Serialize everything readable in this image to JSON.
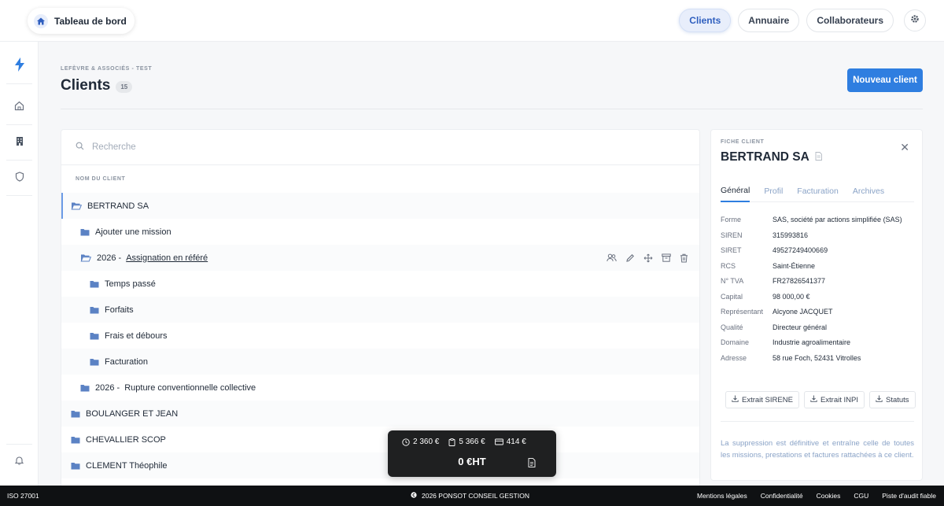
{
  "topbar": {
    "home_label": "Tableau de bord",
    "nav": [
      "Clients",
      "Annuaire",
      "Collaborateurs"
    ],
    "active_nav": "Clients"
  },
  "rail": {
    "icons": [
      "bolt-icon",
      "home-icon",
      "building-icon",
      "shield-icon",
      "bell-icon"
    ]
  },
  "header": {
    "org": "LEFÈVRE & ASSOCIÉS - TEST",
    "title": "Clients",
    "count": "15",
    "new_client": "Nouveau client"
  },
  "search": {
    "placeholder": "Recherche"
  },
  "tree": {
    "column_header": "NOM DU CLIENT",
    "rows": [
      {
        "label": "BERTRAND SA",
        "level": 0,
        "open": true,
        "selected": true
      },
      {
        "label": "Ajouter une mission",
        "level": 1,
        "open": false
      },
      {
        "year": "2026 -",
        "label": "Assignation en référé",
        "level": 1,
        "open": true,
        "has_actions": true
      },
      {
        "label": "Temps passé",
        "level": 2,
        "open": false
      },
      {
        "label": "Forfaits",
        "level": 2,
        "open": false
      },
      {
        "label": "Frais et débours",
        "level": 2,
        "open": false
      },
      {
        "label": "Facturation",
        "level": 2,
        "open": false
      },
      {
        "year": "2026 -",
        "label": "Rupture conventionnelle collective",
        "level": 1,
        "open": false
      },
      {
        "label": "BOULANGER ET JEAN",
        "level": 0,
        "open": false
      },
      {
        "label": "CHEVALLIER SCOP",
        "level": 0,
        "open": false
      },
      {
        "label": "CLEMENT Théophile",
        "level": 0,
        "open": false
      }
    ],
    "row_actions": [
      "users-icon",
      "edit-icon",
      "move-icon",
      "archive-icon",
      "trash-icon"
    ]
  },
  "client_card": {
    "overline": "FICHE CLIENT",
    "name": "BERTRAND SA",
    "tabs": [
      "Général",
      "Profil",
      "Facturation",
      "Archives"
    ],
    "active_tab": "Général",
    "fields": [
      {
        "key": "Forme",
        "value": "SAS, société par actions simplifiée (SAS)"
      },
      {
        "key": "SIREN",
        "value": "315993816"
      },
      {
        "key": "SIRET",
        "value": "49527249400669"
      },
      {
        "key": "RCS",
        "value": "Saint-Étienne"
      },
      {
        "key": "N° TVA",
        "value": "FR27826541377"
      },
      {
        "key": "Capital",
        "value": "98 000,00 €"
      },
      {
        "key": "Représentant",
        "value": "Alcyone JACQUET"
      },
      {
        "key": "Qualité",
        "value": "Directeur général"
      },
      {
        "key": "Domaine",
        "value": "Industrie agroalimentaire"
      },
      {
        "key": "Adresse",
        "value": "58 rue Foch, 52431 Vitrolles"
      }
    ],
    "documents": [
      "Extrait SIRENE",
      "Extrait INPI",
      "Statuts"
    ],
    "warning": "La suppression est définitive et entraîne celle de toutes les missions, prestations et factures rattachées à ce client."
  },
  "totals": {
    "time": "2 360 €",
    "flat": "5 366 €",
    "expenses": "414 €",
    "total": "0 €HT"
  },
  "footer": {
    "left": "ISO 27001",
    "center": "2026 PONSOT CONSEIL GESTION",
    "links": [
      "Mentions légales",
      "Confidentialité",
      "Cookies",
      "CGU",
      "Piste d'audit fiable"
    ]
  },
  "colors": {
    "accent": "#2f7ee0",
    "folder": "#5b82c4",
    "footer_bg": "#0f1113",
    "totals_bg": "#1f2021"
  }
}
